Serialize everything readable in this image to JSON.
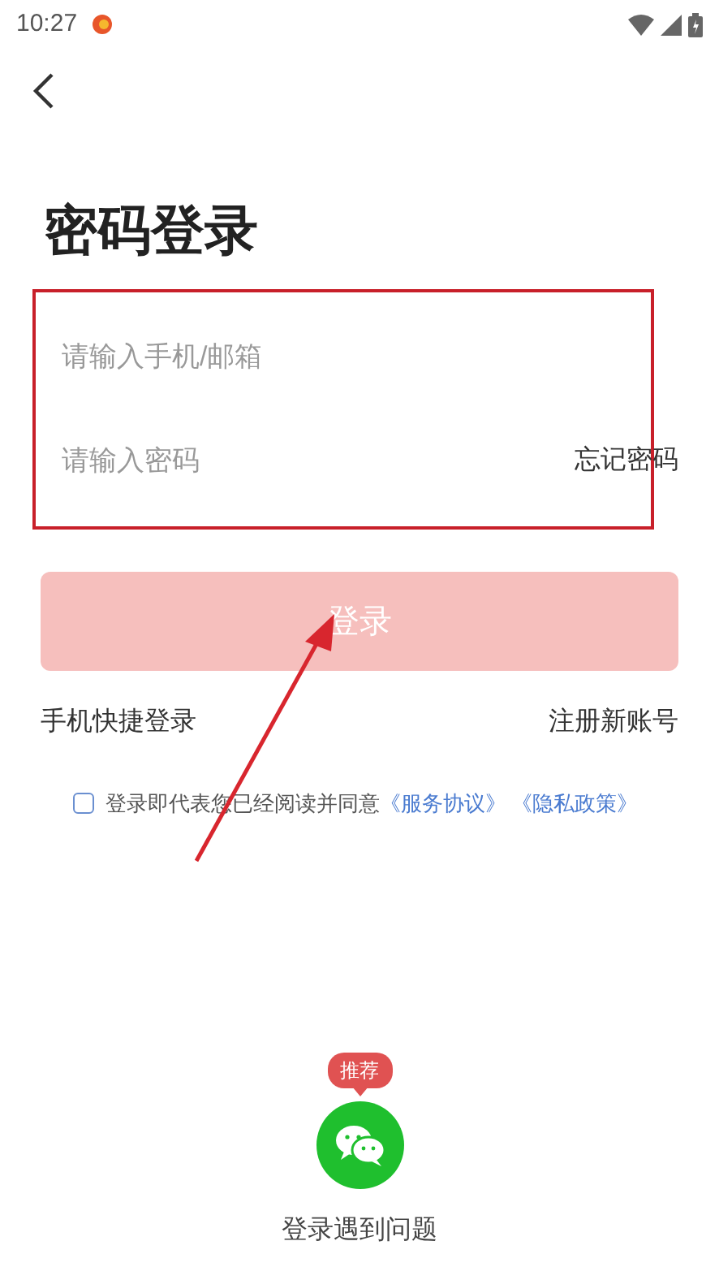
{
  "status_bar": {
    "time": "10:27"
  },
  "title": "密码登录",
  "fields": [
    {
      "placeholder": "请输入手机/邮箱"
    },
    {
      "placeholder": "请输入密码",
      "action": "忘记密码"
    }
  ],
  "login_button": {
    "label": "登录",
    "disabled": true
  },
  "links": {
    "left": "手机快捷登录",
    "right": "注册新账号"
  },
  "agreement": {
    "checked": false,
    "text": "登录即代表您已经阅读并同意",
    "links": [
      "《服务协议》",
      "《隐私政策》"
    ]
  },
  "social": {
    "badge": "推荐"
  },
  "help": "登录遇到问题"
}
